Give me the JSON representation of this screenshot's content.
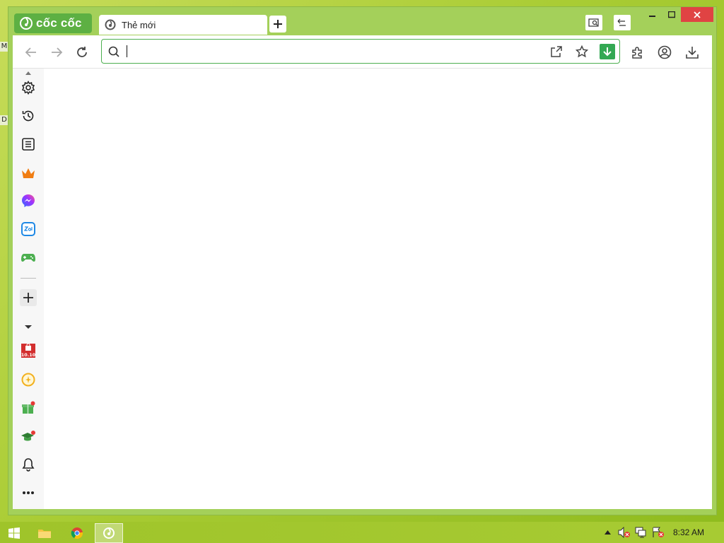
{
  "desktop": {
    "edge_letters": [
      "M",
      "D"
    ]
  },
  "browser": {
    "brand": "cốc cốc",
    "tab": {
      "title": "Thẻ mới"
    },
    "omnibox": {
      "value": "",
      "placeholder": ""
    }
  },
  "sidebar": {
    "top_items": [
      "settings",
      "history",
      "reading-list",
      "crown",
      "messenger",
      "zalo",
      "games"
    ],
    "bottom_items": [
      "shopping-1010",
      "coin-reward",
      "gift",
      "graduation-cap",
      "notifications",
      "more"
    ]
  },
  "taskbar": {
    "clock": "8:32 AM"
  },
  "colors": {
    "accent_green": "#5db043",
    "omnibox_border": "#4caf50",
    "close_red": "#e04343",
    "download_green": "#33a853"
  }
}
